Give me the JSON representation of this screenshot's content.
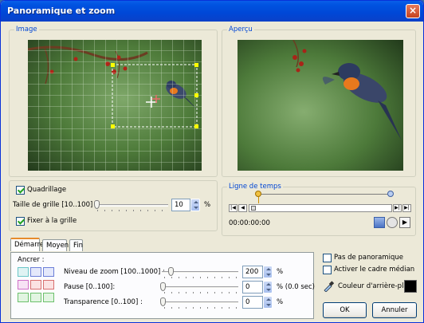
{
  "window": {
    "title": "Panoramique et zoom",
    "close_glyph": "×"
  },
  "image_group": {
    "label": "Image"
  },
  "preview_group": {
    "label": "Aperçu"
  },
  "grid": {
    "show_label": "Quadrillage",
    "show_checked": true,
    "size_label": "Taille de grille [10..100] :",
    "size_value": "10",
    "size_unit": "%",
    "snap_label": "Fixer à la grille",
    "snap_checked": true,
    "size_fraction": 0.0
  },
  "timeline": {
    "label": "Ligne de temps",
    "time": "00:00:00:00"
  },
  "tabs": [
    {
      "label": "Démarrer",
      "active": true
    },
    {
      "label": "Moyen",
      "active": false
    },
    {
      "label": "Fin",
      "active": false
    }
  ],
  "anchor_label": "Ancrer :",
  "zoom": {
    "label": "Niveau de zoom [100..1000] :",
    "value": "200",
    "unit": "%"
  },
  "pause": {
    "label": "Pause [0..100]:",
    "value": "0",
    "unit": "% (0.0 sec)"
  },
  "transparency": {
    "label": "Transparence [0..100] :",
    "value": "0",
    "unit": "%"
  },
  "options": {
    "no_pan_label": "Pas de panoramique",
    "no_pan_checked": false,
    "median_frame_label": "Activer le cadre médian",
    "median_frame_checked": false
  },
  "background_color": {
    "label": "Couleur d'arrière-plan :",
    "color": "#000000"
  },
  "buttons": {
    "ok": "OK",
    "cancel": "Annuler"
  },
  "colors": {
    "title_blue": "#0054e3",
    "group_label": "#0046d5",
    "selection": "#ffff00",
    "bird_breast": "#e8791d"
  }
}
